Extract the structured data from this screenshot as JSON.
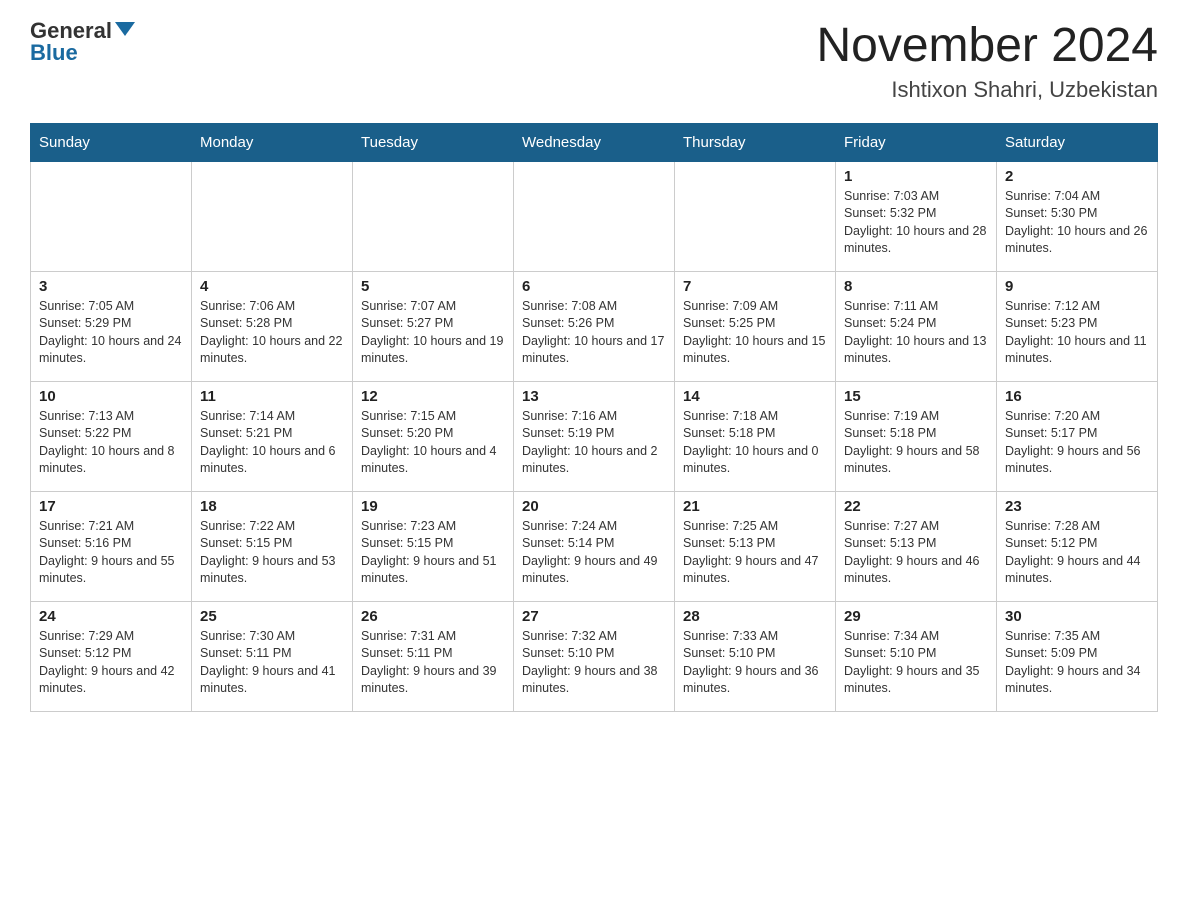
{
  "logo": {
    "general": "General",
    "blue": "Blue"
  },
  "header": {
    "month_year": "November 2024",
    "location": "Ishtixon Shahri, Uzbekistan"
  },
  "days_of_week": [
    "Sunday",
    "Monday",
    "Tuesday",
    "Wednesday",
    "Thursday",
    "Friday",
    "Saturday"
  ],
  "weeks": [
    [
      {
        "day": "",
        "info": ""
      },
      {
        "day": "",
        "info": ""
      },
      {
        "day": "",
        "info": ""
      },
      {
        "day": "",
        "info": ""
      },
      {
        "day": "",
        "info": ""
      },
      {
        "day": "1",
        "info": "Sunrise: 7:03 AM\nSunset: 5:32 PM\nDaylight: 10 hours and 28 minutes."
      },
      {
        "day": "2",
        "info": "Sunrise: 7:04 AM\nSunset: 5:30 PM\nDaylight: 10 hours and 26 minutes."
      }
    ],
    [
      {
        "day": "3",
        "info": "Sunrise: 7:05 AM\nSunset: 5:29 PM\nDaylight: 10 hours and 24 minutes."
      },
      {
        "day": "4",
        "info": "Sunrise: 7:06 AM\nSunset: 5:28 PM\nDaylight: 10 hours and 22 minutes."
      },
      {
        "day": "5",
        "info": "Sunrise: 7:07 AM\nSunset: 5:27 PM\nDaylight: 10 hours and 19 minutes."
      },
      {
        "day": "6",
        "info": "Sunrise: 7:08 AM\nSunset: 5:26 PM\nDaylight: 10 hours and 17 minutes."
      },
      {
        "day": "7",
        "info": "Sunrise: 7:09 AM\nSunset: 5:25 PM\nDaylight: 10 hours and 15 minutes."
      },
      {
        "day": "8",
        "info": "Sunrise: 7:11 AM\nSunset: 5:24 PM\nDaylight: 10 hours and 13 minutes."
      },
      {
        "day": "9",
        "info": "Sunrise: 7:12 AM\nSunset: 5:23 PM\nDaylight: 10 hours and 11 minutes."
      }
    ],
    [
      {
        "day": "10",
        "info": "Sunrise: 7:13 AM\nSunset: 5:22 PM\nDaylight: 10 hours and 8 minutes."
      },
      {
        "day": "11",
        "info": "Sunrise: 7:14 AM\nSunset: 5:21 PM\nDaylight: 10 hours and 6 minutes."
      },
      {
        "day": "12",
        "info": "Sunrise: 7:15 AM\nSunset: 5:20 PM\nDaylight: 10 hours and 4 minutes."
      },
      {
        "day": "13",
        "info": "Sunrise: 7:16 AM\nSunset: 5:19 PM\nDaylight: 10 hours and 2 minutes."
      },
      {
        "day": "14",
        "info": "Sunrise: 7:18 AM\nSunset: 5:18 PM\nDaylight: 10 hours and 0 minutes."
      },
      {
        "day": "15",
        "info": "Sunrise: 7:19 AM\nSunset: 5:18 PM\nDaylight: 9 hours and 58 minutes."
      },
      {
        "day": "16",
        "info": "Sunrise: 7:20 AM\nSunset: 5:17 PM\nDaylight: 9 hours and 56 minutes."
      }
    ],
    [
      {
        "day": "17",
        "info": "Sunrise: 7:21 AM\nSunset: 5:16 PM\nDaylight: 9 hours and 55 minutes."
      },
      {
        "day": "18",
        "info": "Sunrise: 7:22 AM\nSunset: 5:15 PM\nDaylight: 9 hours and 53 minutes."
      },
      {
        "day": "19",
        "info": "Sunrise: 7:23 AM\nSunset: 5:15 PM\nDaylight: 9 hours and 51 minutes."
      },
      {
        "day": "20",
        "info": "Sunrise: 7:24 AM\nSunset: 5:14 PM\nDaylight: 9 hours and 49 minutes."
      },
      {
        "day": "21",
        "info": "Sunrise: 7:25 AM\nSunset: 5:13 PM\nDaylight: 9 hours and 47 minutes."
      },
      {
        "day": "22",
        "info": "Sunrise: 7:27 AM\nSunset: 5:13 PM\nDaylight: 9 hours and 46 minutes."
      },
      {
        "day": "23",
        "info": "Sunrise: 7:28 AM\nSunset: 5:12 PM\nDaylight: 9 hours and 44 minutes."
      }
    ],
    [
      {
        "day": "24",
        "info": "Sunrise: 7:29 AM\nSunset: 5:12 PM\nDaylight: 9 hours and 42 minutes."
      },
      {
        "day": "25",
        "info": "Sunrise: 7:30 AM\nSunset: 5:11 PM\nDaylight: 9 hours and 41 minutes."
      },
      {
        "day": "26",
        "info": "Sunrise: 7:31 AM\nSunset: 5:11 PM\nDaylight: 9 hours and 39 minutes."
      },
      {
        "day": "27",
        "info": "Sunrise: 7:32 AM\nSunset: 5:10 PM\nDaylight: 9 hours and 38 minutes."
      },
      {
        "day": "28",
        "info": "Sunrise: 7:33 AM\nSunset: 5:10 PM\nDaylight: 9 hours and 36 minutes."
      },
      {
        "day": "29",
        "info": "Sunrise: 7:34 AM\nSunset: 5:10 PM\nDaylight: 9 hours and 35 minutes."
      },
      {
        "day": "30",
        "info": "Sunrise: 7:35 AM\nSunset: 5:09 PM\nDaylight: 9 hours and 34 minutes."
      }
    ]
  ]
}
